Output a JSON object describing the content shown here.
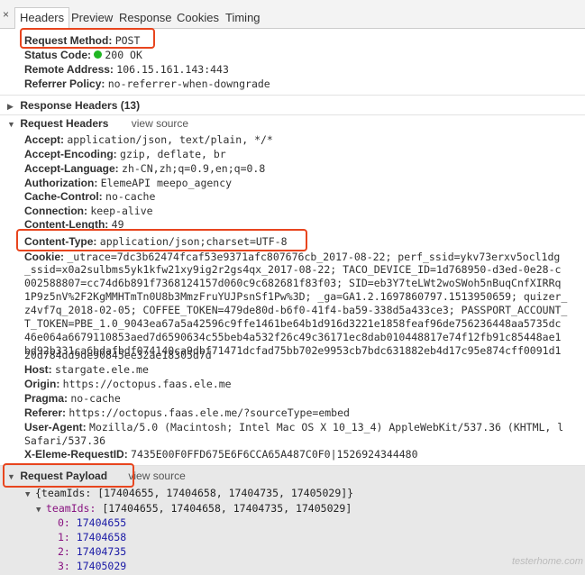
{
  "tabs": {
    "close": "×",
    "items": [
      "Headers",
      "Preview",
      "Response",
      "Cookies",
      "Timing"
    ]
  },
  "general": {
    "method_key": "Request Method:",
    "method_val": "POST",
    "status_key": "Status Code:",
    "status_val": "200 OK",
    "remote_key": "Remote Address:",
    "remote_val": "106.15.161.143:443",
    "referrer_policy_key": "Referrer Policy:",
    "referrer_policy_val": "no-referrer-when-downgrade"
  },
  "response_headers": {
    "title": "Response Headers (13)"
  },
  "request_headers": {
    "title": "Request Headers",
    "view_source": "view source",
    "accept_key": "Accept:",
    "accept_val": "application/json, text/plain, */*",
    "encoding_key": "Accept-Encoding:",
    "encoding_val": "gzip, deflate, br",
    "language_key": "Accept-Language:",
    "language_val": "zh-CN,zh;q=0.9,en;q=0.8",
    "auth_key": "Authorization:",
    "auth_val": "ElemeAPI meepo_agency",
    "cache_key": "Cache-Control:",
    "cache_val": "no-cache",
    "connection_key": "Connection:",
    "connection_val": "keep-alive",
    "length_key": "Content-Length:",
    "length_val": "49",
    "ctype_key": "Content-Type:",
    "ctype_val": "application/json;charset=UTF-8",
    "cookie_key": "Cookie:",
    "cookie_lines": [
      "_utrace=7dc3b62474fcaf53e9371afc807676cb_2017-08-22; perf_ssid=ykv73erxv5ocl1dg",
      "_ssid=x0a2sulbms5yk1kfw21xy9ig2r2gs4qx_2017-08-22; TACO_DEVICE_ID=1d768950-d3ed-0e28-c",
      "002588807=cc74d6b891f7368124157d060c9c682681f83f03; SID=eb3Y7teLWt2woSWoh5nBuqCnfXIRRq",
      "1P9z5nV%2F2KgMMHTmTn0U8b3MmzFruYUJPsnSf1Pw%3D; _ga=GA1.2.1697860797.1513950659; quizer_",
      "z4vf7q_2018-02-05; COFFEE_TOKEN=479de80d-b6f0-41f4-ba59-338d5a433ce3; PASSPORT_ACCOUNT_",
      "T_TOKEN=PBE_1.0_9043ea67a5a42596c9ffe1461be64b1d916d3221e1858feaf96de756236448aa5735dc",
      "46e064a6679110853aed7d6590634c55beb4a532f26c49c36171ec8dab010448817e74f12fb91c85448ae1",
      "bd92b331ca6bdafbdf074140ca9dbf71471dcfad75bb702e9953cb7bdc631882eb4d17c95e874cff0091d1",
      "20d784dd9de90845ee32ae18305d7d"
    ],
    "host_key": "Host:",
    "host_val": "stargate.ele.me",
    "origin_key": "Origin:",
    "origin_val": "https://octopus.faas.ele.me",
    "pragma_key": "Pragma:",
    "pragma_val": "no-cache",
    "referer_key": "Referer:",
    "referer_val": "https://octopus.faas.ele.me/?sourceType=embed",
    "ua_key": "User-Agent:",
    "ua_val": "Mozilla/5.0 (Macintosh; Intel Mac OS X 10_13_4) AppleWebKit/537.36 (KHTML, l",
    "ua_val2": "Safari/537.36",
    "xeleme_key": "X-Eleme-RequestID:",
    "xeleme_val": "7435E00F0FFD675E6F6CCA65A487C0F0|1526924344480"
  },
  "payload": {
    "title": "Request Payload",
    "view_source": "view source",
    "root_line": "{teamIds: [17404655, 17404658, 17404735, 17405029]}",
    "teamids_key": "teamIds:",
    "teamids_summary": "[17404655, 17404658, 17404735, 17405029]",
    "items": [
      {
        "index": "0:",
        "value": "17404655"
      },
      {
        "index": "1:",
        "value": "17404658"
      },
      {
        "index": "2:",
        "value": "17404735"
      },
      {
        "index": "3:",
        "value": "17405029"
      }
    ]
  },
  "watermark": "testerhome.com",
  "colors": {
    "highlight": "#e8451e",
    "status_ok": "#1fb622",
    "key_purple": "#881280",
    "number_blue": "#1a1aa6"
  }
}
